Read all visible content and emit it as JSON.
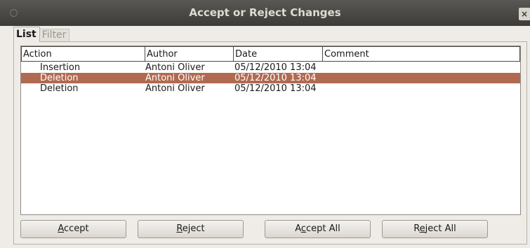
{
  "window": {
    "title": "Accept or Reject Changes",
    "close_glyph": "×"
  },
  "tabs": [
    {
      "label": "List",
      "active": true
    },
    {
      "label": "Filter",
      "active": false
    }
  ],
  "table": {
    "columns": [
      "Action",
      "Author",
      "Date",
      "Comment"
    ],
    "rows": [
      {
        "action": "Insertion",
        "author": "Antoni Oliver",
        "date": "05/12/2010 13:04",
        "comment": "",
        "selected": false
      },
      {
        "action": "Deletion",
        "author": "Antoni Oliver",
        "date": "05/12/2010 13:04",
        "comment": "",
        "selected": true
      },
      {
        "action": "Deletion",
        "author": "Antoni Oliver",
        "date": "05/12/2010 13:04",
        "comment": "",
        "selected": false
      }
    ]
  },
  "buttons": {
    "accept": {
      "mnemonic": "A",
      "rest": "ccept"
    },
    "reject": {
      "mnemonic": "R",
      "rest": "eject"
    },
    "accept_all": {
      "pre": "A",
      "mnemonic": "c",
      "rest": "cept All"
    },
    "reject_all": {
      "pre": "R",
      "mnemonic": "e",
      "rest": "ject All"
    }
  },
  "colors": {
    "selection": "#b06a51",
    "titlebar": "#3c3b37",
    "background": "#efebe7"
  }
}
